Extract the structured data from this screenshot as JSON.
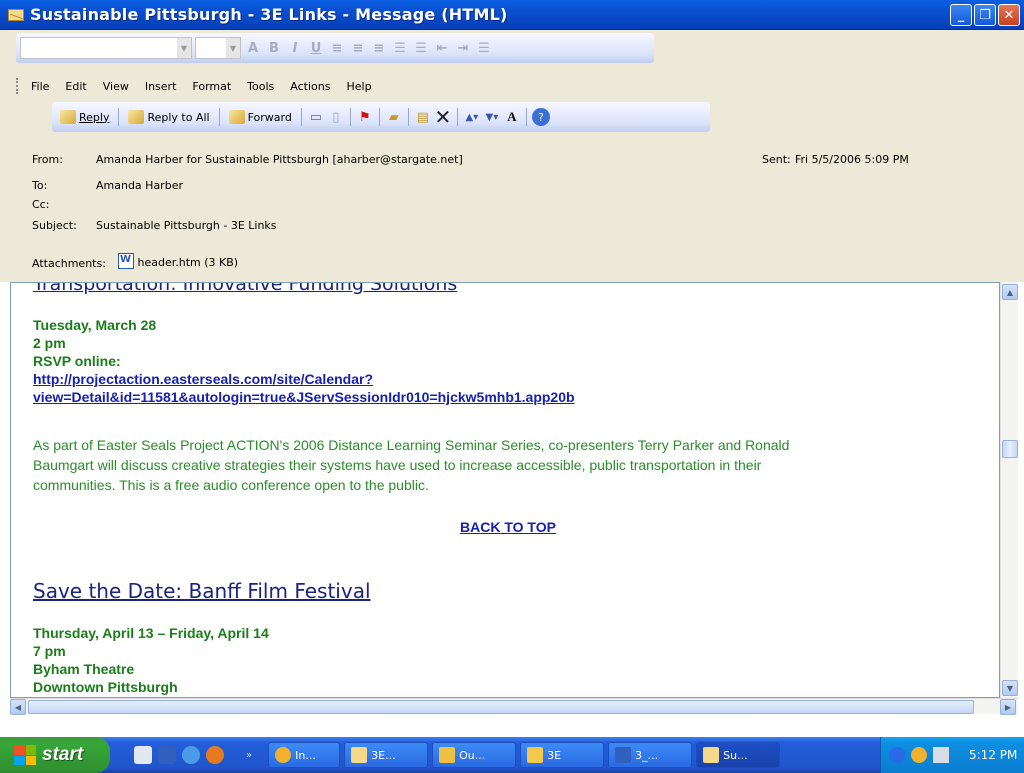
{
  "window": {
    "title": "Sustainable Pittsburgh - 3E Links - Message (HTML)",
    "buttons": [
      "minimize",
      "restore",
      "close"
    ]
  },
  "menu": [
    "File",
    "Edit",
    "View",
    "Insert",
    "Format",
    "Tools",
    "Actions",
    "Help"
  ],
  "toolbar": {
    "reply": "Reply",
    "reply_all": "Reply to All",
    "forward": "Forward"
  },
  "header": {
    "from_label": "From:",
    "from_value": "Amanda Harber for Sustainable Pittsburgh [aharber@stargate.net]",
    "sent_label": "Sent:",
    "sent_value": "Fri 5/5/2006 5:09 PM",
    "to_label": "To:",
    "to_value": "Amanda Harber",
    "cc_label": "Cc:",
    "subject_label": "Subject:",
    "subject_value": "Sustainable Pittsburgh - 3E Links",
    "attachments_label": "Attachments:",
    "attachment_name": "header.htm (3 KB)"
  },
  "message": {
    "cut_heading": "Transportation: Innovative Funding Solutions",
    "event1": {
      "date": "Tuesday, March 28",
      "time": "2 pm",
      "rsvp": "RSVP online:",
      "link_line1": "http://projectaction.easterseals.com/site/Calendar?",
      "link_line2": "view=Detail&id=11581&autologin=true&JServSessionIdr010=hjckw5mhb1.app20b",
      "para_line1": "As part of Easter Seals Project ACTION's 2006 Distance Learning Seminar Series, co-presenters Terry Parker and Ronald",
      "para_line2": "Baumgart will discuss creative strategies their systems have used to increase accessible, public transportation in their",
      "para_line3": "communities. This is a free audio conference open to the public."
    },
    "back_to_top": "BACK TO TOP",
    "heading2": "Save the Date: Banff Film Festival",
    "event2": {
      "date": "Thursday, April 13 – Friday, April 14",
      "time": "7 pm",
      "venue": "Byham Theatre",
      "location": "Downtown Pittsburgh"
    }
  },
  "taskbar": {
    "start": "start",
    "tasks": [
      "In...",
      "3E...",
      "Ou...",
      "3E",
      "3_...",
      "Su..."
    ],
    "clock": "5:12 PM"
  }
}
